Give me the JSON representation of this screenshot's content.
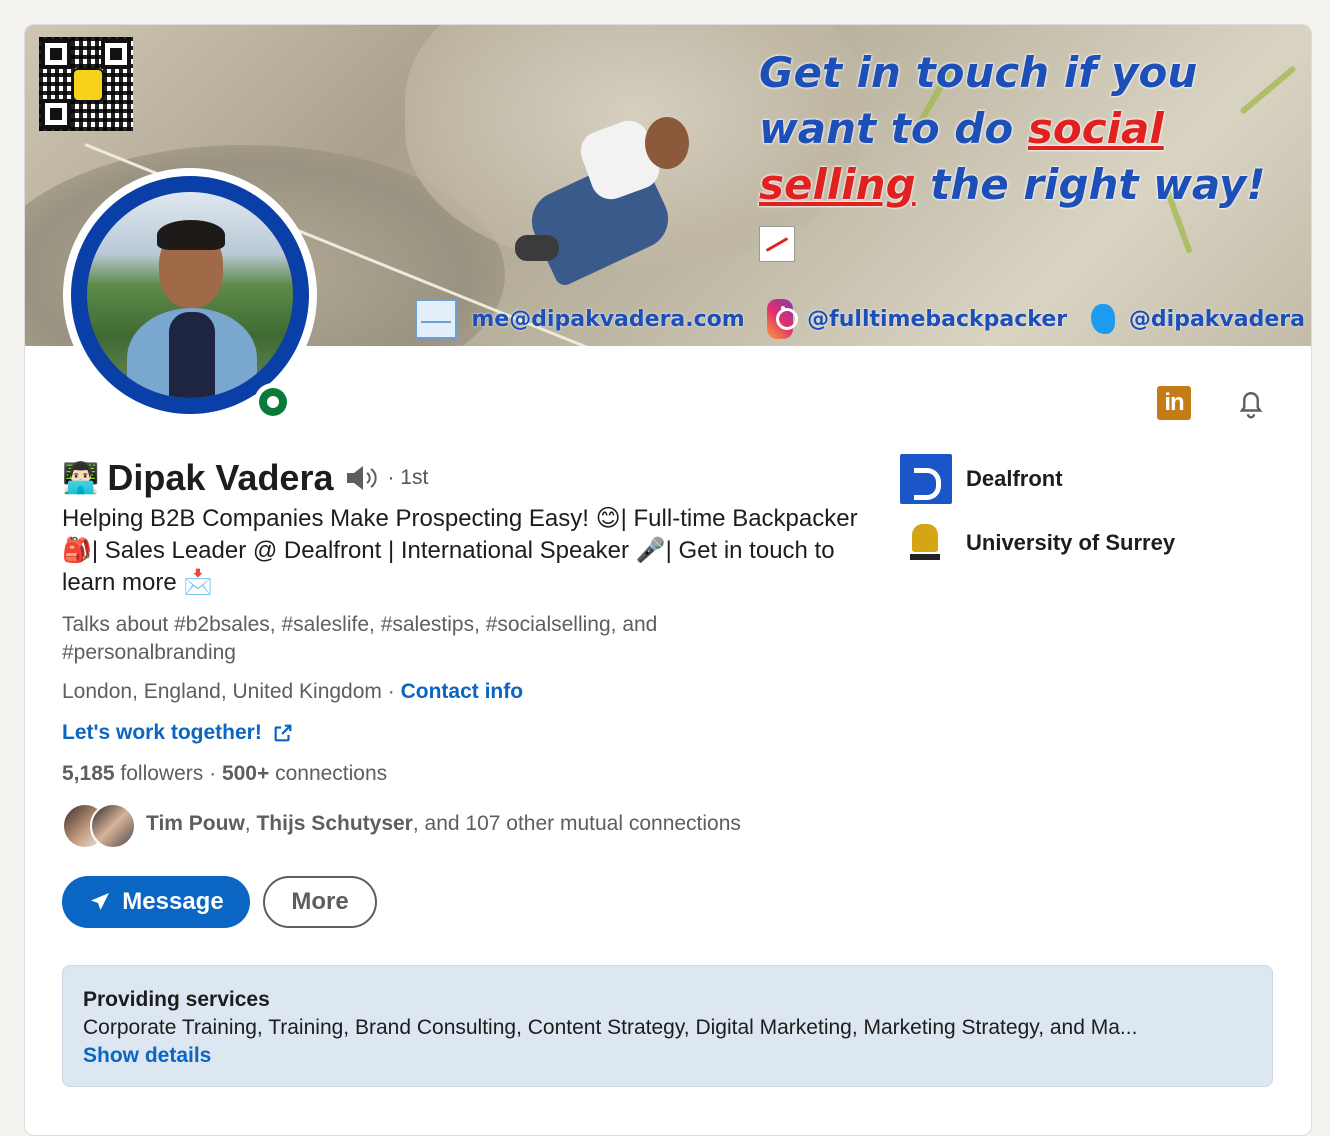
{
  "banner": {
    "line1": "Get in touch if you",
    "line2_a": "want to do ",
    "line2_red": "social",
    "line3_red": "selling",
    "line3_b": " the right way!",
    "email": "me@dipakvadera.com",
    "instagram": "@fulltimebackpacker",
    "twitter": "@dipakvadera"
  },
  "profile": {
    "emoji": "👨🏻‍💻",
    "name": "Dipak Vadera",
    "degree": "· 1st",
    "headline": "Helping B2B Companies Make Prospecting Easy! 😊| Full-time Backpacker 🎒| Sales Leader @ Dealfront | International Speaker 🎤| Get in touch to learn more 📩",
    "talks_about": "Talks about #b2bsales, #saleslife, #salestips, #socialselling, and #personalbranding",
    "location": "London, England, United Kingdom",
    "location_sep": " · ",
    "contact_info": "Contact info",
    "website": "Let's work together!",
    "followers_count": "5,185",
    "followers_label": " followers",
    "connections_sep": "  · ",
    "connections_count": "500+",
    "connections_label": " connections",
    "mutual_name1": "Tim Pouw",
    "mutual_sep": ", ",
    "mutual_name2": "Thijs Schutyser",
    "mutual_rest": ", and 107 other mutual connections"
  },
  "actions": {
    "message": "Message",
    "more": "More"
  },
  "orgs": [
    {
      "name": "Dealfront"
    },
    {
      "name": "University of Surrey"
    }
  ],
  "top_icons": {
    "linkedin_label": "in"
  },
  "services": {
    "title": "Providing services",
    "list": "Corporate Training, Training, Brand Consulting, Content Strategy, Digital Marketing, Marketing Strategy, and Ma...",
    "link": "Show details"
  },
  "colors": {
    "accent": "#0a66c2",
    "online": "#0a7a3a",
    "avatar_ring": "#0a3fa8",
    "services_bg": "#dde7f1"
  }
}
